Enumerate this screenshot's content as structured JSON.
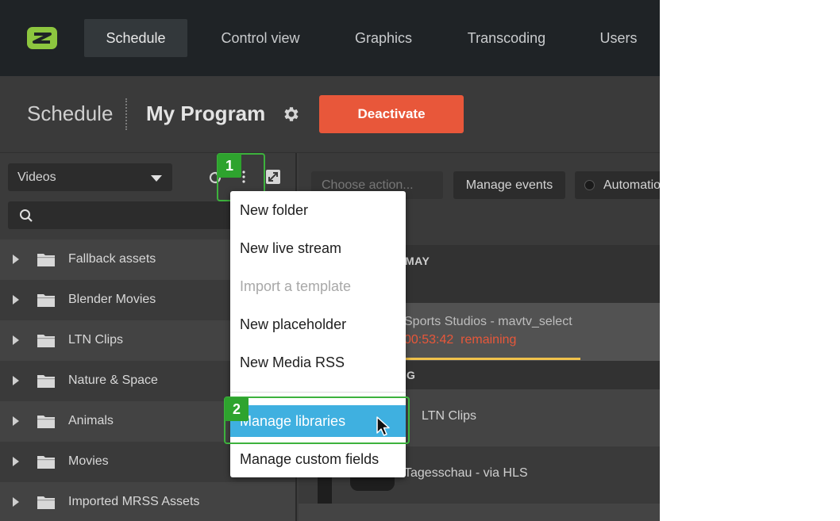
{
  "nav": {
    "items": [
      {
        "label": "Schedule",
        "active": true
      },
      {
        "label": "Control view",
        "active": false
      },
      {
        "label": "Graphics",
        "active": false
      },
      {
        "label": "Transcoding",
        "active": false
      },
      {
        "label": "Users",
        "active": false
      }
    ]
  },
  "header": {
    "section": "Schedule",
    "program_name": "My Program",
    "deactivate_label": "Deactivate"
  },
  "library": {
    "selected_type": "Videos",
    "search_placeholder": "",
    "folders": [
      "Fallback assets",
      "Blender Movies",
      "LTN Clips",
      "Nature & Space",
      "Animals",
      "Movies",
      "Imported MRSS Assets"
    ]
  },
  "schedule_toolbar": {
    "choose_action": "Choose action...",
    "manage_events": "Manage events",
    "automation": "Automation"
  },
  "schedule": {
    "day_label": "MAY",
    "current_event_title": "Sports Studios - mavtv_select",
    "current_event_time": "00:53:42",
    "current_event_remaining": "remaining",
    "section_label": "G",
    "events": [
      {
        "title": "LTN Clips"
      },
      {
        "title": "Tagesschau - via HLS"
      }
    ]
  },
  "menu": {
    "items": [
      {
        "label": "New folder",
        "disabled": false
      },
      {
        "label": "New live stream",
        "disabled": false
      },
      {
        "label": "Import a template",
        "disabled": true
      },
      {
        "label": "New placeholder",
        "disabled": false
      },
      {
        "label": "New Media RSS",
        "disabled": false
      },
      {
        "label": "Manage libraries",
        "disabled": false,
        "highlighted": true
      },
      {
        "label": "Manage custom fields",
        "disabled": false
      }
    ]
  },
  "steps": [
    {
      "number": "1"
    },
    {
      "number": "2"
    }
  ],
  "colors": {
    "accent_green": "#8dc63f",
    "deactivate": "#e8573a",
    "highlight": "#3fb0e0",
    "step_green": "#2ea32e",
    "progress": "#f0c24b"
  },
  "icons": {
    "logo": "app-logo",
    "settings": "gear-icon",
    "refresh": "refresh-icon",
    "more": "kebab-menu-icon",
    "expand": "expand-icon",
    "search": "search-icon",
    "folder": "folder-icon",
    "caret": "caret-right-icon",
    "cursor": "mouse-cursor-icon"
  }
}
